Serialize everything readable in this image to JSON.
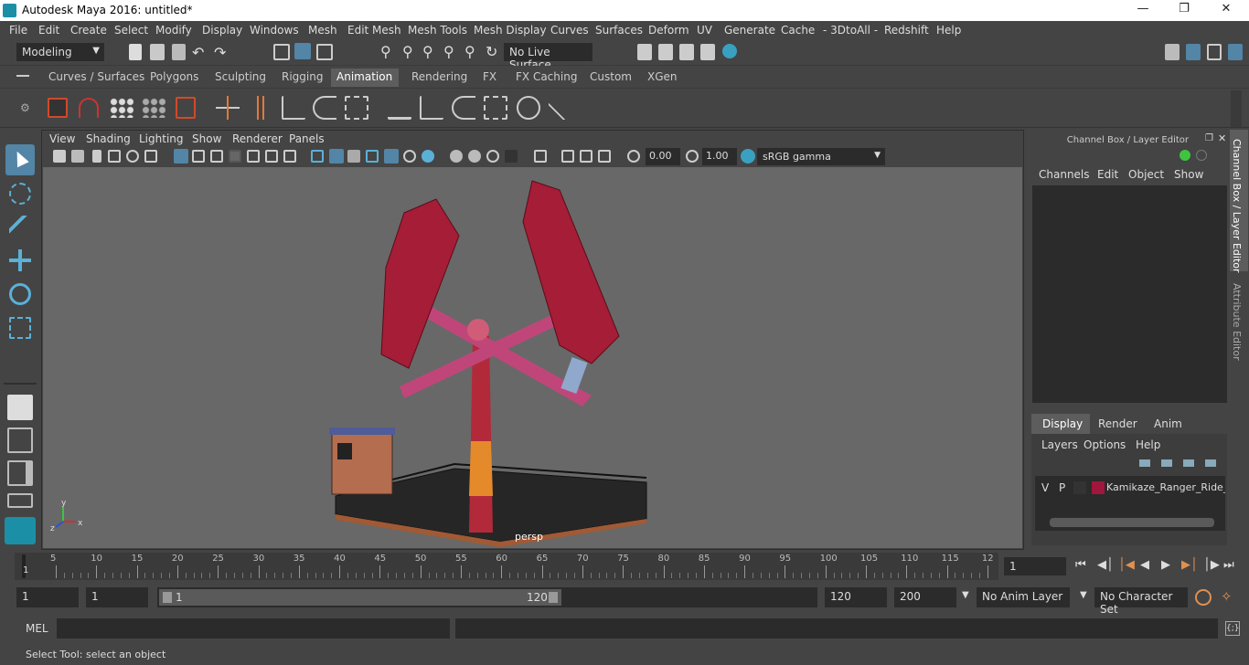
{
  "window": {
    "title": "Autodesk Maya 2016: untitled*"
  },
  "menubar": [
    "File",
    "Edit",
    "Create",
    "Select",
    "Modify",
    "Display",
    "Windows",
    "Mesh",
    "Edit Mesh",
    "Mesh Tools",
    "Mesh Display",
    "Curves",
    "Surfaces",
    "Deform",
    "UV",
    "Generate",
    "Cache",
    "- 3DtoAll -",
    "Redshift",
    "Help"
  ],
  "statusline": {
    "menu_set": "Modeling",
    "live_surface": "No Live Surface"
  },
  "shelf_tabs": [
    "Curves / Surfaces",
    "Polygons",
    "Sculpting",
    "Rigging",
    "Animation",
    "Rendering",
    "FX",
    "FX Caching",
    "Custom",
    "XGen"
  ],
  "active_shelf_tab": "Animation",
  "viewport": {
    "menu": [
      "View",
      "Shading",
      "Lighting",
      "Show",
      "Renderer",
      "Panels"
    ],
    "field_a": "0.00",
    "field_b": "1.00",
    "color_space": "sRGB gamma",
    "camera_label": "persp",
    "axis_y": "y",
    "axis_x": "x",
    "axis_z": "z"
  },
  "channel_box": {
    "title": "Channel Box / Layer Editor",
    "menu": [
      "Channels",
      "Edit",
      "Object",
      "Show"
    ]
  },
  "layer_editor": {
    "tabs": [
      "Display",
      "Render",
      "Anim"
    ],
    "active_tab": "Display",
    "menu": [
      "Layers",
      "Options",
      "Help"
    ],
    "layer": {
      "v": "V",
      "p": "P",
      "name": "Kamikaze_Ranger_Ride_A",
      "color": "#a0163c"
    }
  },
  "side_tabs": [
    "Channel Box / Layer Editor",
    "Attribute Editor"
  ],
  "timeline": {
    "ticks": [
      "5",
      "10",
      "15",
      "20",
      "25",
      "30",
      "35",
      "40",
      "45",
      "50",
      "55",
      "60",
      "65",
      "70",
      "75",
      "80",
      "85",
      "90",
      "95",
      "100",
      "105",
      "110",
      "115",
      "12"
    ],
    "start_marker": "1",
    "current_frame": "1"
  },
  "range": {
    "start": "1",
    "anim_start": "1",
    "slider_start": "1",
    "slider_end": "120",
    "end": "120",
    "anim_end": "200",
    "anim_layer": "No Anim Layer",
    "char_set": "No Character Set"
  },
  "command": {
    "label": "MEL"
  },
  "help": {
    "text": "Select Tool: select an object"
  },
  "colors": {
    "accent": "#5285a6",
    "viewport_bg": "#686868",
    "panel": "#444444"
  }
}
